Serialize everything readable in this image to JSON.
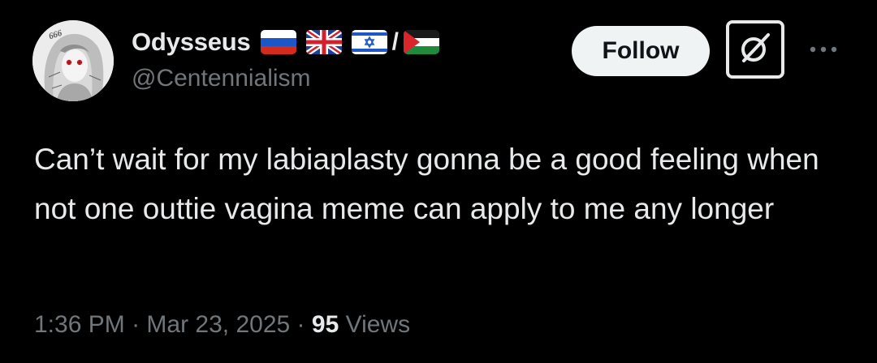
{
  "user": {
    "display_name": "Odysseus",
    "handle": "@Centennialism",
    "avatar_text": "666",
    "flags": [
      "russia-flag",
      "uk-flag",
      "israel-flag",
      "palestine-flag"
    ],
    "flag_separator": "/"
  },
  "actions": {
    "follow_label": "Follow",
    "grok_icon": "grok-icon",
    "more_icon": "more-icon"
  },
  "tweet": {
    "text": "Can’t wait for my labiaplasty gonna be a good feeling when not one outtie vagina meme can apply to me any longer",
    "time": "1:36 PM",
    "separator": "·",
    "date": "Mar 23, 2025",
    "views_count": "95",
    "views_label": "Views"
  },
  "colors": {
    "background": "#000000",
    "primary_text": "#e7e9ea",
    "secondary_text": "#71767b",
    "follow_bg": "#eff3f4",
    "follow_text": "#0f1419"
  }
}
